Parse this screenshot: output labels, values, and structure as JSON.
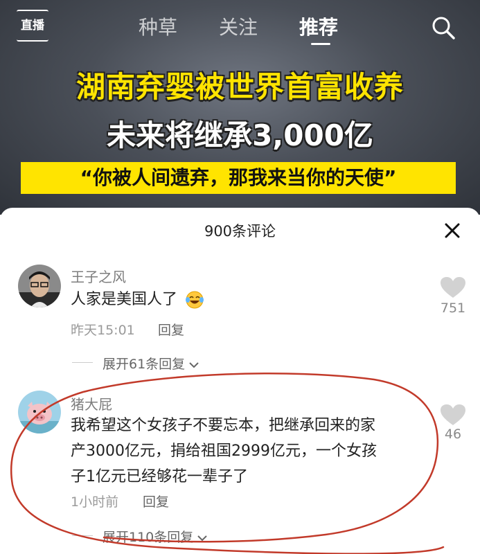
{
  "topnav": {
    "live_label": "直播",
    "tabs": [
      {
        "label": "种草"
      },
      {
        "label": "关注"
      },
      {
        "label": "推荐",
        "active": true
      }
    ]
  },
  "video": {
    "headline_line1": "湖南弃婴被世界首富收养",
    "headline_line2": "未来将继承3,000亿",
    "banner": "“你被人间遗弃，那我来当你的天使”"
  },
  "comments_panel": {
    "title": "900条评论",
    "comments": [
      {
        "username": "王子之风",
        "text": "人家是美国人了",
        "emoji": "laughing-tears-emoji",
        "time": "昨天15:01",
        "reply_label": "回复",
        "likes": "751",
        "expand_label": "展开61条回复"
      },
      {
        "username": "猪大屁",
        "text_lines": [
          "我希望这个女孩子不要忘本，把继承回来的家",
          "产3000亿元，捐给祖国2999亿元，一个女孩",
          "子1亿元已经够花一辈子了"
        ],
        "time": "1小时前",
        "reply_label": "回复",
        "likes": "46",
        "expand_label": "展开110条回复"
      }
    ]
  },
  "colors": {
    "headline_yellow": "#ffe400",
    "annotation_red": "#c23a2a"
  }
}
